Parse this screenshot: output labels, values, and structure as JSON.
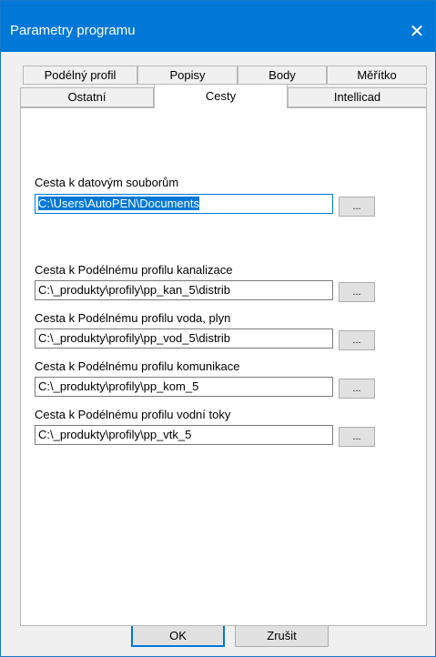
{
  "window": {
    "title": "Parametry programu",
    "close_symbol": "✕"
  },
  "tabs": {
    "row1": [
      "Podélný profil",
      "Popisy",
      "Body",
      "Měřítko"
    ],
    "row2": [
      "Ostatní",
      "Cesty",
      "Intellicad"
    ],
    "active": "Cesty"
  },
  "fields": [
    {
      "label": "Cesta k datovým souborům",
      "value": "C:\\Users\\AutoPEN\\Documents",
      "button": "..."
    },
    {
      "label": "Cesta k Podélnému profilu kanalizace",
      "value": "C:\\_produkty\\profily\\pp_kan_5\\distrib",
      "button": "..."
    },
    {
      "label": "Cesta k Podélnému profilu voda, plyn",
      "value": "C:\\_produkty\\profily\\pp_vod_5\\distrib",
      "button": "..."
    },
    {
      "label": "Cesta k Podélnému profilu komunikace",
      "value": "C:\\_produkty\\profily\\pp_kom_5",
      "button": "..."
    },
    {
      "label": "Cesta k Podélnému profilu vodní toky",
      "value": "C:\\_produkty\\profily\\pp_vtk_5",
      "button": "..."
    }
  ],
  "buttons": {
    "ok": "OK",
    "cancel": "Zrušit"
  },
  "colors": {
    "titlebar": "#0078d7",
    "selection": "#0078d7",
    "dialog_bg": "#f0f0f0"
  }
}
